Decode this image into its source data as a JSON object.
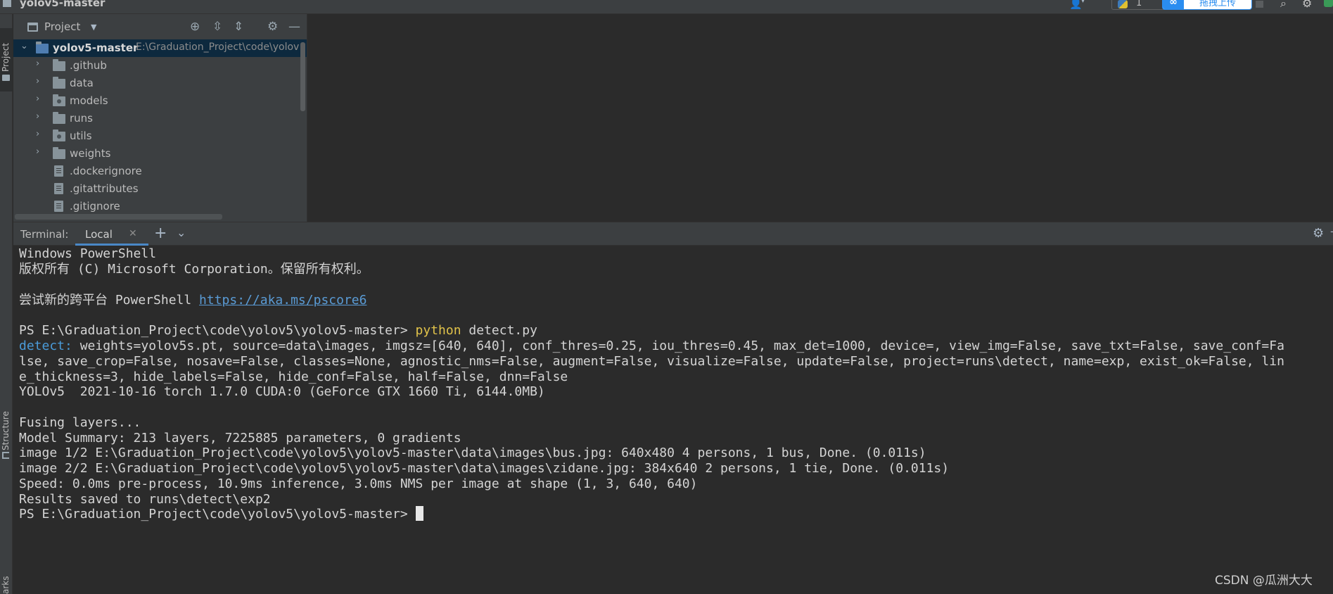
{
  "window": {
    "title": "yolov5-master",
    "run_config_number": "1",
    "upload_label": "拖拽上传",
    "upload_logo": "∞"
  },
  "left_strip": {
    "project_tab": "Project",
    "structure_tab": "Structure",
    "bookmarks_tab": "arks"
  },
  "project_panel": {
    "title": "Project",
    "root": {
      "name": "yolov5-master",
      "path": "E:\\Graduation_Project\\code\\yolov"
    },
    "items": [
      {
        "name": ".github",
        "type": "folder"
      },
      {
        "name": "data",
        "type": "folder"
      },
      {
        "name": "models",
        "type": "package"
      },
      {
        "name": "runs",
        "type": "folder"
      },
      {
        "name": "utils",
        "type": "package"
      },
      {
        "name": "weights",
        "type": "folder"
      },
      {
        "name": ".dockerignore",
        "type": "file"
      },
      {
        "name": ".gitattributes",
        "type": "file"
      },
      {
        "name": ".gitignore",
        "type": "file"
      }
    ]
  },
  "terminal": {
    "label": "Terminal:",
    "tab": "Local",
    "lines": {
      "l1": "Windows PowerShell",
      "l2": "版权所有 (C) Microsoft Corporation。保留所有权利。",
      "l4_prefix": "尝试新的跨平台 PowerShell ",
      "l4_link": "https://aka.ms/pscore6",
      "l6_prompt": "PS E:\\Graduation_Project\\code\\yolov5\\yolov5-master> ",
      "l6_cmd": "python",
      "l6_args": " detect.py",
      "l7_key": "detect:",
      "l7_rest": " weights=yolov5s.pt, source=data\\images, imgsz=[640, 640], conf_thres=0.25, iou_thres=0.45, max_det=1000, device=, view_img=False, save_txt=False, save_conf=Fa",
      "l8": "lse, save_crop=False, nosave=False, classes=None, agnostic_nms=False, augment=False, visualize=False, update=False, project=runs\\detect, name=exp, exist_ok=False, lin",
      "l9": "e_thickness=3, hide_labels=False, hide_conf=False, half=False, dnn=False",
      "l10": "YOLOv5  2021-10-16 torch 1.7.0 CUDA:0 (GeForce GTX 1660 Ti, 6144.0MB)",
      "l12": "Fusing layers...",
      "l13": "Model Summary: 213 layers, 7225885 parameters, 0 gradients",
      "l14": "image 1/2 E:\\Graduation_Project\\code\\yolov5\\yolov5-master\\data\\images\\bus.jpg: 640x480 4 persons, 1 bus, Done. (0.011s)",
      "l15": "image 2/2 E:\\Graduation_Project\\code\\yolov5\\yolov5-master\\data\\images\\zidane.jpg: 384x640 2 persons, 1 tie, Done. (0.011s)",
      "l16": "Speed: 0.0ms pre-process, 10.9ms inference, 3.0ms NMS per image at shape (1, 3, 640, 640)",
      "l17": "Results saved to runs\\detect\\exp2",
      "l18": "PS E:\\Graduation_Project\\code\\yolov5\\yolov5-master> "
    }
  },
  "watermark": "CSDN @瓜洲大大"
}
